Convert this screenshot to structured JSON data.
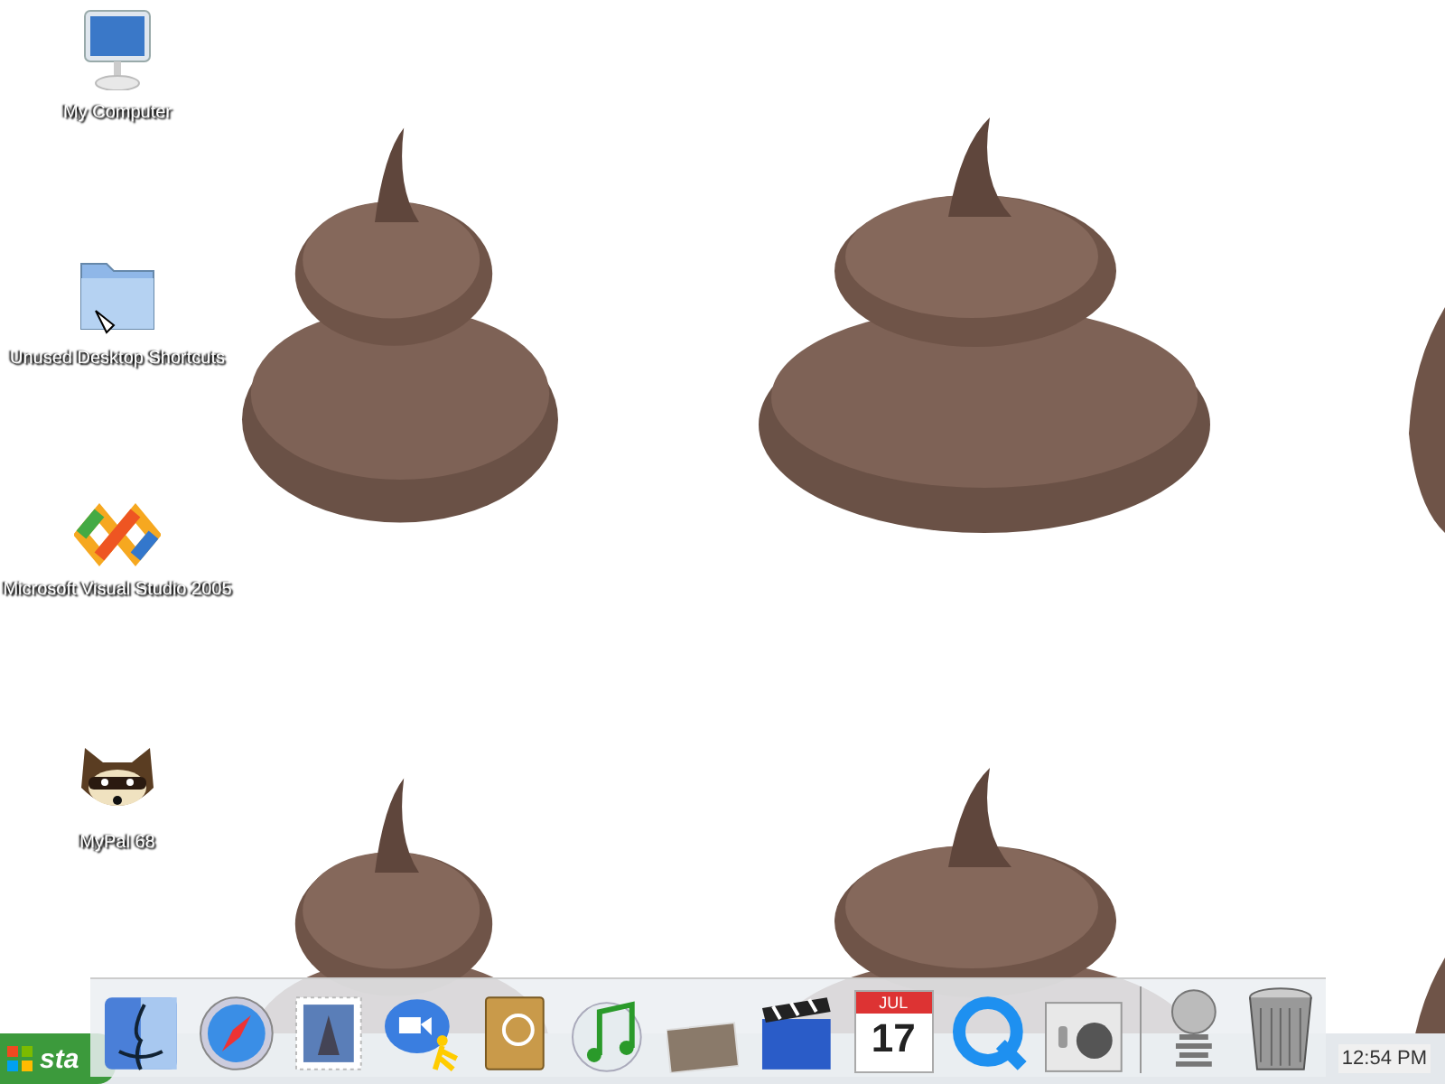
{
  "desktop_icons": [
    {
      "kind": "monitor",
      "label": "My Computer"
    },
    {
      "kind": "folder",
      "label": "Unused Desktop Shortcuts"
    },
    {
      "kind": "infinity",
      "label": "Microsoft Visual Studio 2005"
    },
    {
      "kind": "raccoon",
      "label": "MyPal 68"
    }
  ],
  "start_button": {
    "label": "sta"
  },
  "dock": {
    "items": [
      {
        "kind": "face"
      },
      {
        "kind": "compass"
      },
      {
        "kind": "stamp"
      },
      {
        "kind": "chat"
      },
      {
        "kind": "book"
      },
      {
        "kind": "music"
      },
      {
        "kind": "photo"
      },
      {
        "kind": "clapper"
      },
      {
        "kind": "calendar",
        "month": "JUL",
        "day": "17"
      },
      {
        "kind": "circle-q"
      },
      {
        "kind": "panel"
      },
      {
        "kind": "separator"
      },
      {
        "kind": "at"
      },
      {
        "kind": "trash"
      }
    ]
  },
  "clock": "12:54 PM"
}
